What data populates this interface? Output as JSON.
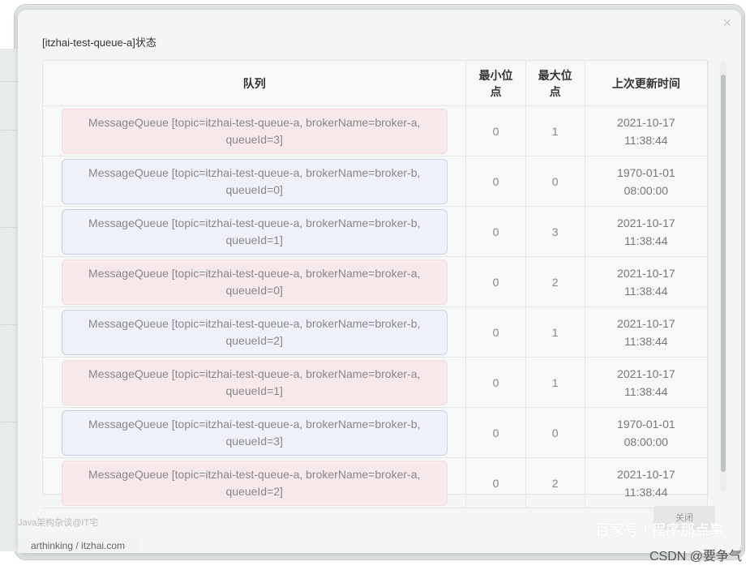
{
  "modal": {
    "title": "[itzhai-test-queue-a]状态",
    "close_icon_glyph": "×",
    "close_button_label": "关闭"
  },
  "table": {
    "headers": {
      "queue": "队列",
      "min_offset": "最小位点",
      "max_offset": "最大位点",
      "last_update": "上次更新时间"
    },
    "rows": [
      {
        "queue": "MessageQueue [topic=itzhai-test-queue-a, brokerName=broker-a, queueId=3]",
        "min": "0",
        "max": "1",
        "date": "2021-10-17",
        "time": "11:38:44",
        "color": "#f7e9e9"
      },
      {
        "queue": "MessageQueue [topic=itzhai-test-queue-a, brokerName=broker-b, queueId=0]",
        "min": "0",
        "max": "0",
        "date": "1970-01-01",
        "time": "08:00:00",
        "color": "#eef1f7"
      },
      {
        "queue": "MessageQueue [topic=itzhai-test-queue-a, brokerName=broker-b, queueId=1]",
        "min": "0",
        "max": "3",
        "date": "2021-10-17",
        "time": "11:38:44",
        "color": "#eef1f7"
      },
      {
        "queue": "MessageQueue [topic=itzhai-test-queue-a, brokerName=broker-a, queueId=0]",
        "min": "0",
        "max": "2",
        "date": "2021-10-17",
        "time": "11:38:44",
        "color": "#f7e9e9"
      },
      {
        "queue": "MessageQueue [topic=itzhai-test-queue-a, brokerName=broker-b, queueId=2]",
        "min": "0",
        "max": "1",
        "date": "2021-10-17",
        "time": "11:38:44",
        "color": "#eef1f7"
      },
      {
        "queue": "MessageQueue [topic=itzhai-test-queue-a, brokerName=broker-a, queueId=1]",
        "min": "0",
        "max": "1",
        "date": "2021-10-17",
        "time": "11:38:44",
        "color": "#f7e9e9"
      },
      {
        "queue": "MessageQueue [topic=itzhai-test-queue-a, brokerName=broker-b, queueId=3]",
        "min": "0",
        "max": "0",
        "date": "1970-01-01",
        "time": "08:00:00",
        "color": "#eef1f7"
      },
      {
        "queue": "MessageQueue [topic=itzhai-test-queue-a, brokerName=broker-a, queueId=2]",
        "min": "0",
        "max": "2",
        "date": "2021-10-17",
        "time": "11:38:44",
        "color": "#f7e9e9"
      }
    ]
  },
  "watermarks": {
    "left_top": "Java架构杂谈@IT宅",
    "left_bottom": "arthinking / itzhai.com",
    "right_top": "百家号 / 程序那点事",
    "right_bottom": "CSDN @要争气"
  }
}
